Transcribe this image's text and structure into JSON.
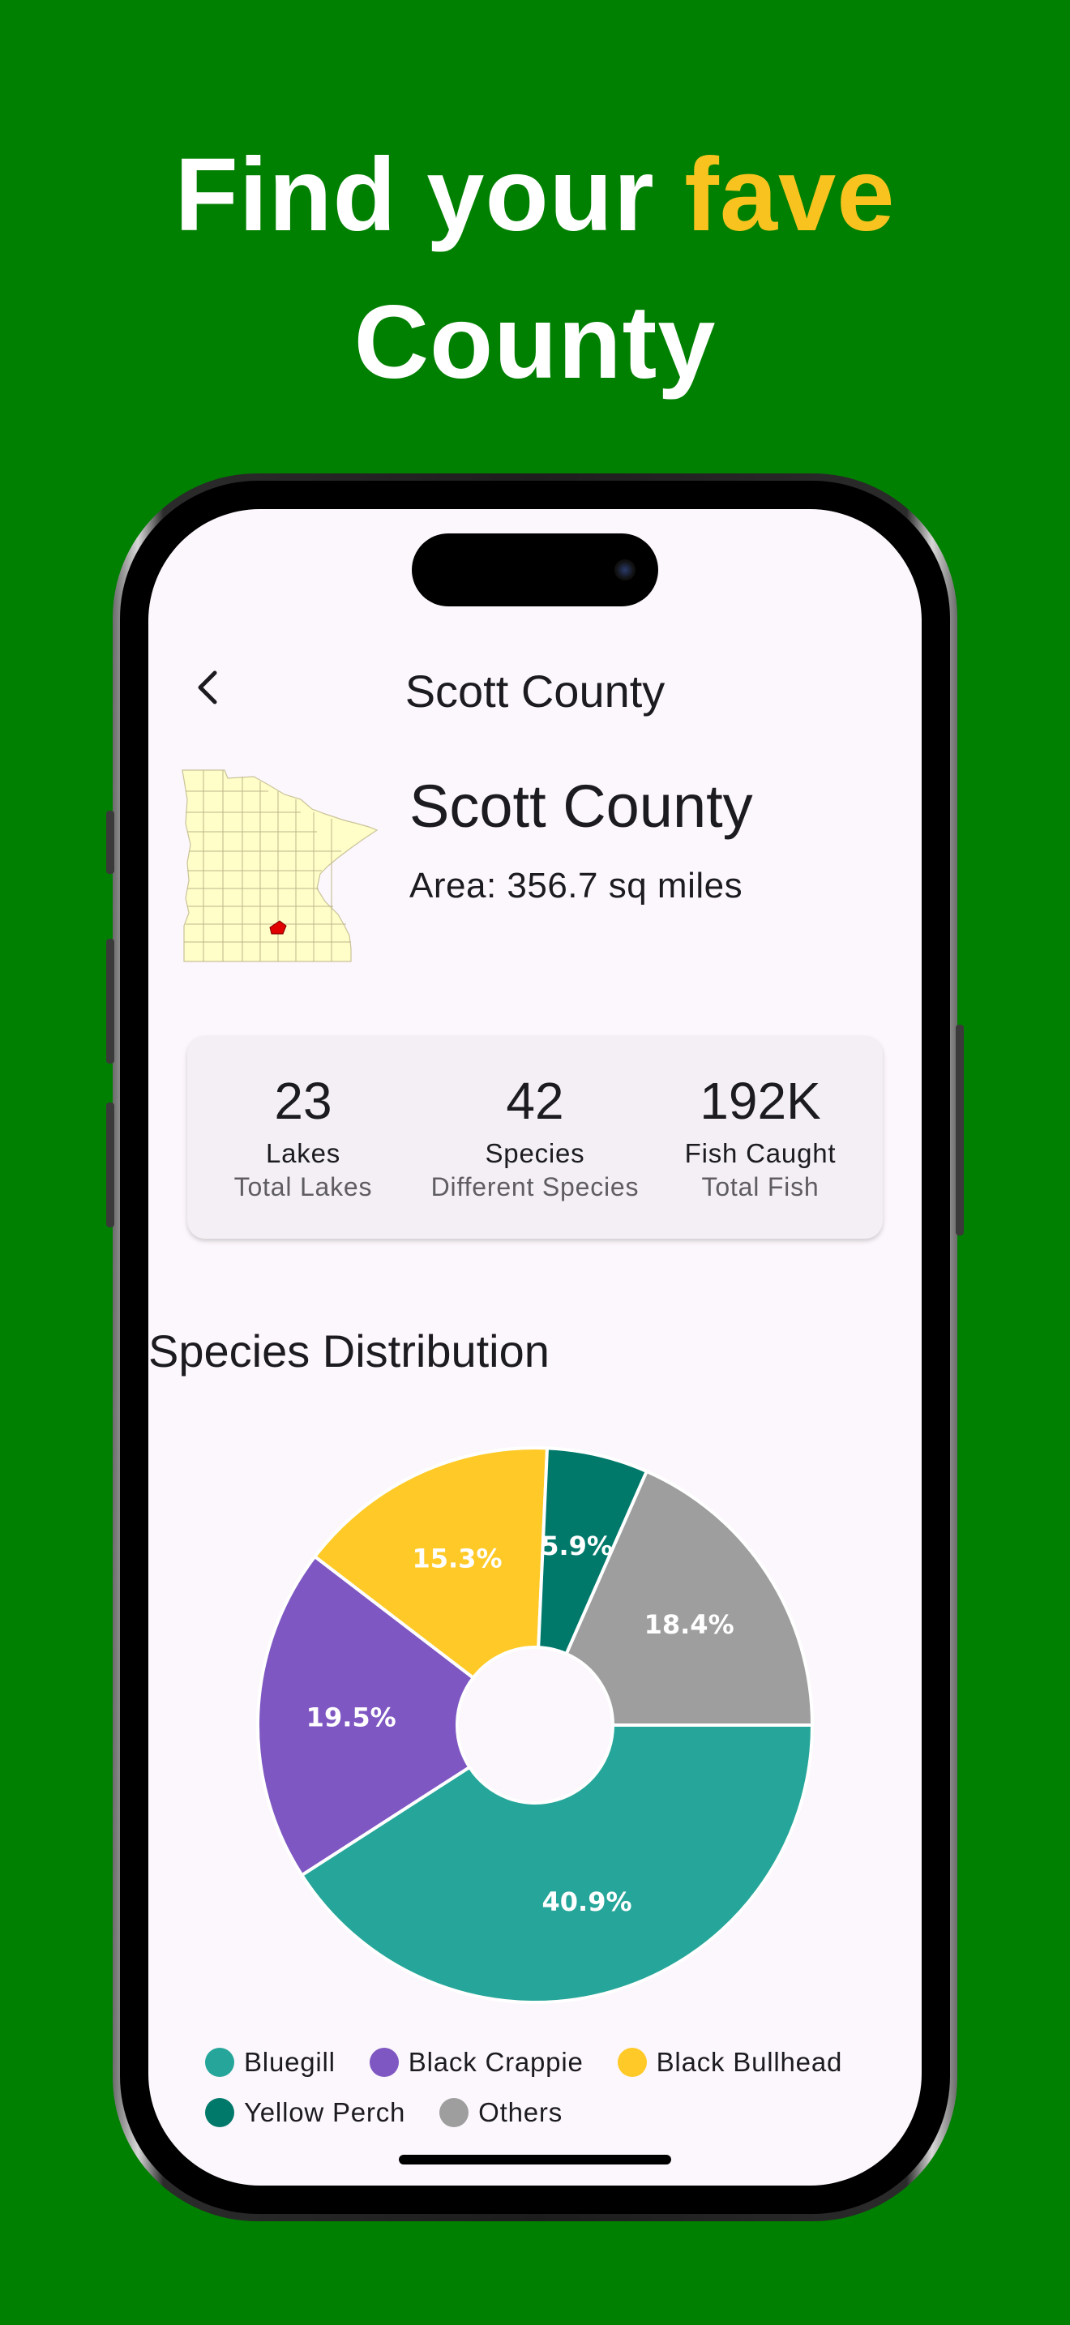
{
  "headline": {
    "part1": "Find your ",
    "accent": "fave",
    "part2": "County"
  },
  "appbar": {
    "title": "Scott County"
  },
  "county": {
    "name": "Scott County",
    "area": "Area: 356.7 sq miles"
  },
  "stats": [
    {
      "value": "23",
      "label": "Lakes",
      "sub": "Total Lakes"
    },
    {
      "value": "42",
      "label": "Species",
      "sub": "Different Species"
    },
    {
      "value": "192K",
      "label": "Fish Caught",
      "sub": "Total Fish"
    }
  ],
  "section": {
    "title": "Species Distribution"
  },
  "colors": {
    "background": "#008000",
    "accent": "#F9C31F",
    "bluegill": "#26A69A",
    "black_crappie": "#7E57C2",
    "black_bullhead": "#FFCA28",
    "yellow_perch": "#00796B",
    "others": "#9E9E9E"
  },
  "chart_data": {
    "type": "pie",
    "title": "Species Distribution",
    "donut": true,
    "series": [
      {
        "name": "Bluegill",
        "value": 40.9,
        "label": "40.9%",
        "color": "#26A69A"
      },
      {
        "name": "Black Crappie",
        "value": 19.5,
        "label": "19.5%",
        "color": "#7E57C2"
      },
      {
        "name": "Black Bullhead",
        "value": 15.3,
        "label": "15.3%",
        "color": "#FFCA28"
      },
      {
        "name": "Yellow Perch",
        "value": 5.9,
        "label": "5.9%",
        "color": "#00796B"
      },
      {
        "name": "Others",
        "value": 18.4,
        "label": "18.4%",
        "color": "#9E9E9E"
      }
    ],
    "legend_position": "bottom"
  }
}
